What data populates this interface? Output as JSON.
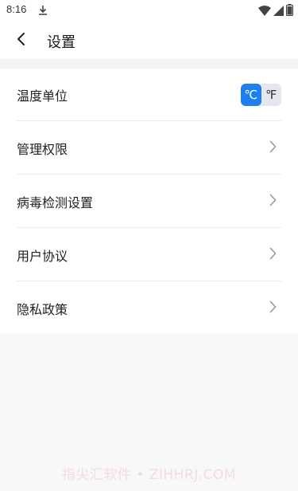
{
  "status_bar": {
    "time": "8:16"
  },
  "header": {
    "title": "设置"
  },
  "settings": [
    {
      "label": "温度单位"
    },
    {
      "label": "管理权限"
    },
    {
      "label": "病毒检测设置"
    },
    {
      "label": "用户协议"
    },
    {
      "label": "隐私政策"
    }
  ],
  "temperature_unit": {
    "options": [
      "℃",
      "℉"
    ],
    "selected": "℃",
    "active_color": "#1e7ff0"
  },
  "watermark": "指尖汇软件 • ZIHHRJ.COM",
  "icons": [
    "download-icon",
    "wifi-icon",
    "signal-icon",
    "battery-icon",
    "back-arrow-icon",
    "chevron-right-icon"
  ]
}
